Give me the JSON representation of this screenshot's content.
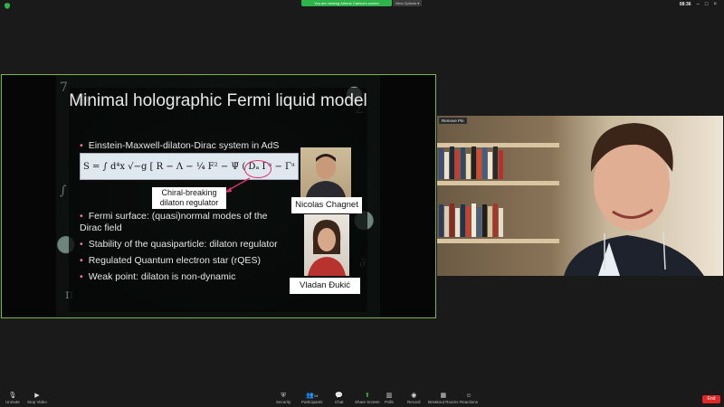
{
  "top_bar": {
    "banner_text": "You are viewing Alfredo Carbon's screen",
    "view_options": "View Options ▾",
    "time": "08:36",
    "icons": [
      "minimize-icon",
      "maximize-icon",
      "close-icon"
    ]
  },
  "shared_screen": {
    "slide": {
      "title": "Minimal holographic Fermi liquid model",
      "bullets": [
        "Einstein-Maxwell-dilaton-Dirac system in AdS",
        "Fermi surface: (quasi)normal modes of the Dirac field",
        "Stability of the quasiparticle: dilaton regulator",
        "Regulated Quantum electron star (rQES)",
        "Weak point: dilaton is non-dynamic"
      ],
      "equation": "S = ∫ d⁴x √−g [ R − Λ − ¼ F² − Ψ̄ ( Dₐ Γᵃ − Γᵃ Φ − m ) Ψ ]",
      "callout": "Chiral-breaking dilaton regulator",
      "people": [
        {
          "name": "Nicolas Chagnet"
        },
        {
          "name": "Vladan Đukić"
        }
      ]
    }
  },
  "video": {
    "remove_pin": "Remove Pin"
  },
  "toolbar": {
    "items": [
      {
        "label": "Unmute",
        "icon": "mic-muted-icon"
      },
      {
        "label": "Stop Video",
        "icon": "video-icon"
      },
      {
        "label": "Security",
        "icon": "shield-icon"
      },
      {
        "label": "Participants",
        "icon": "participants-icon",
        "count": "14"
      },
      {
        "label": "Chat",
        "icon": "chat-icon"
      },
      {
        "label": "Share Screen",
        "icon": "share-screen-icon"
      },
      {
        "label": "Polls",
        "icon": "polls-icon"
      },
      {
        "label": "Record",
        "icon": "record-icon"
      },
      {
        "label": "Breakout Rooms",
        "icon": "breakout-icon"
      },
      {
        "label": "Reactions",
        "icon": "reactions-icon"
      }
    ],
    "end_label": "End"
  },
  "colors": {
    "active_border": "#7db640",
    "end_button": "#e02828",
    "share_green": "#2db34a"
  }
}
